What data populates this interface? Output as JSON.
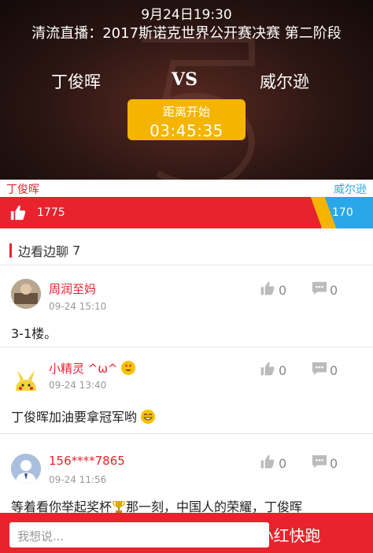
{
  "header": {
    "datetime": "9月24日19:30",
    "title": "清流直播：2017斯诺克世界公开赛决赛 第二阶段",
    "player_a": "丁俊晖",
    "vs": "VS",
    "player_b": "威尔逊",
    "countdown_label": "距离开始",
    "countdown_value": "03:45:35"
  },
  "vote": {
    "player_a": "丁俊晖",
    "player_b": "威尔逊",
    "count_a": "1775",
    "count_b": "170",
    "share_a": 0.86,
    "color_a": "#e8232e",
    "color_b": "#2aa7e8",
    "color_sep": "#f5b400",
    "icon": "thumbs-up-icon"
  },
  "chat": {
    "section_title": "边看边聊",
    "count": "7",
    "comments": [
      {
        "user": "周润至妈",
        "time": "09-24 15:10",
        "text": "3-1楼。",
        "likes": "0",
        "replies": "0"
      },
      {
        "user": "小精灵 ^ω^",
        "time": "09-24 13:40",
        "text": "丁俊晖加油要拿冠军哟",
        "likes": "0",
        "replies": "0"
      },
      {
        "user": "156****7865",
        "time": "09-24 11:56",
        "text_a": "等着看你举起奖杯",
        "text_b": "那一刻，中国人的荣耀，丁俊晖",
        "likes": "0",
        "replies": "0"
      }
    ]
  },
  "input": {
    "placeholder": "我想说..."
  },
  "watermark": "头条号 / 小红快跑"
}
